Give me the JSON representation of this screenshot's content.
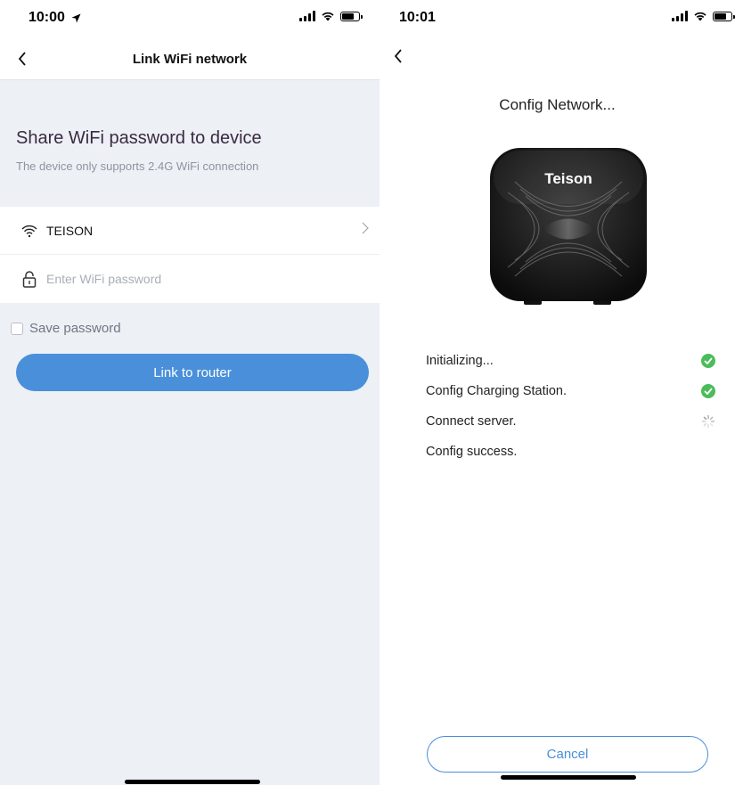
{
  "left": {
    "status_bar": {
      "time": "10:00"
    },
    "nav": {
      "title": "Link WiFi network"
    },
    "share": {
      "title": "Share WiFi password to device",
      "subtitle": "The device only supports 2.4G WiFi connection"
    },
    "wifi": {
      "ssid": "TEISON"
    },
    "password": {
      "placeholder": "Enter WiFi password",
      "value": ""
    },
    "save_password": {
      "label": "Save password",
      "checked": false
    },
    "link_button": {
      "label": "Link to router"
    }
  },
  "right": {
    "status_bar": {
      "time": "10:01"
    },
    "title": "Config Network...",
    "device": {
      "brand": "Teison"
    },
    "steps": [
      {
        "label": "Initializing...",
        "status": "done"
      },
      {
        "label": "Config Charging Station.",
        "status": "done"
      },
      {
        "label": "Connect server.",
        "status": "loading"
      },
      {
        "label": "Config success.",
        "status": "pending"
      }
    ],
    "cancel_button": {
      "label": "Cancel"
    }
  },
  "colors": {
    "accent": "#4a8fd9",
    "success": "#4cbc5b",
    "background": "#edf0f5"
  }
}
